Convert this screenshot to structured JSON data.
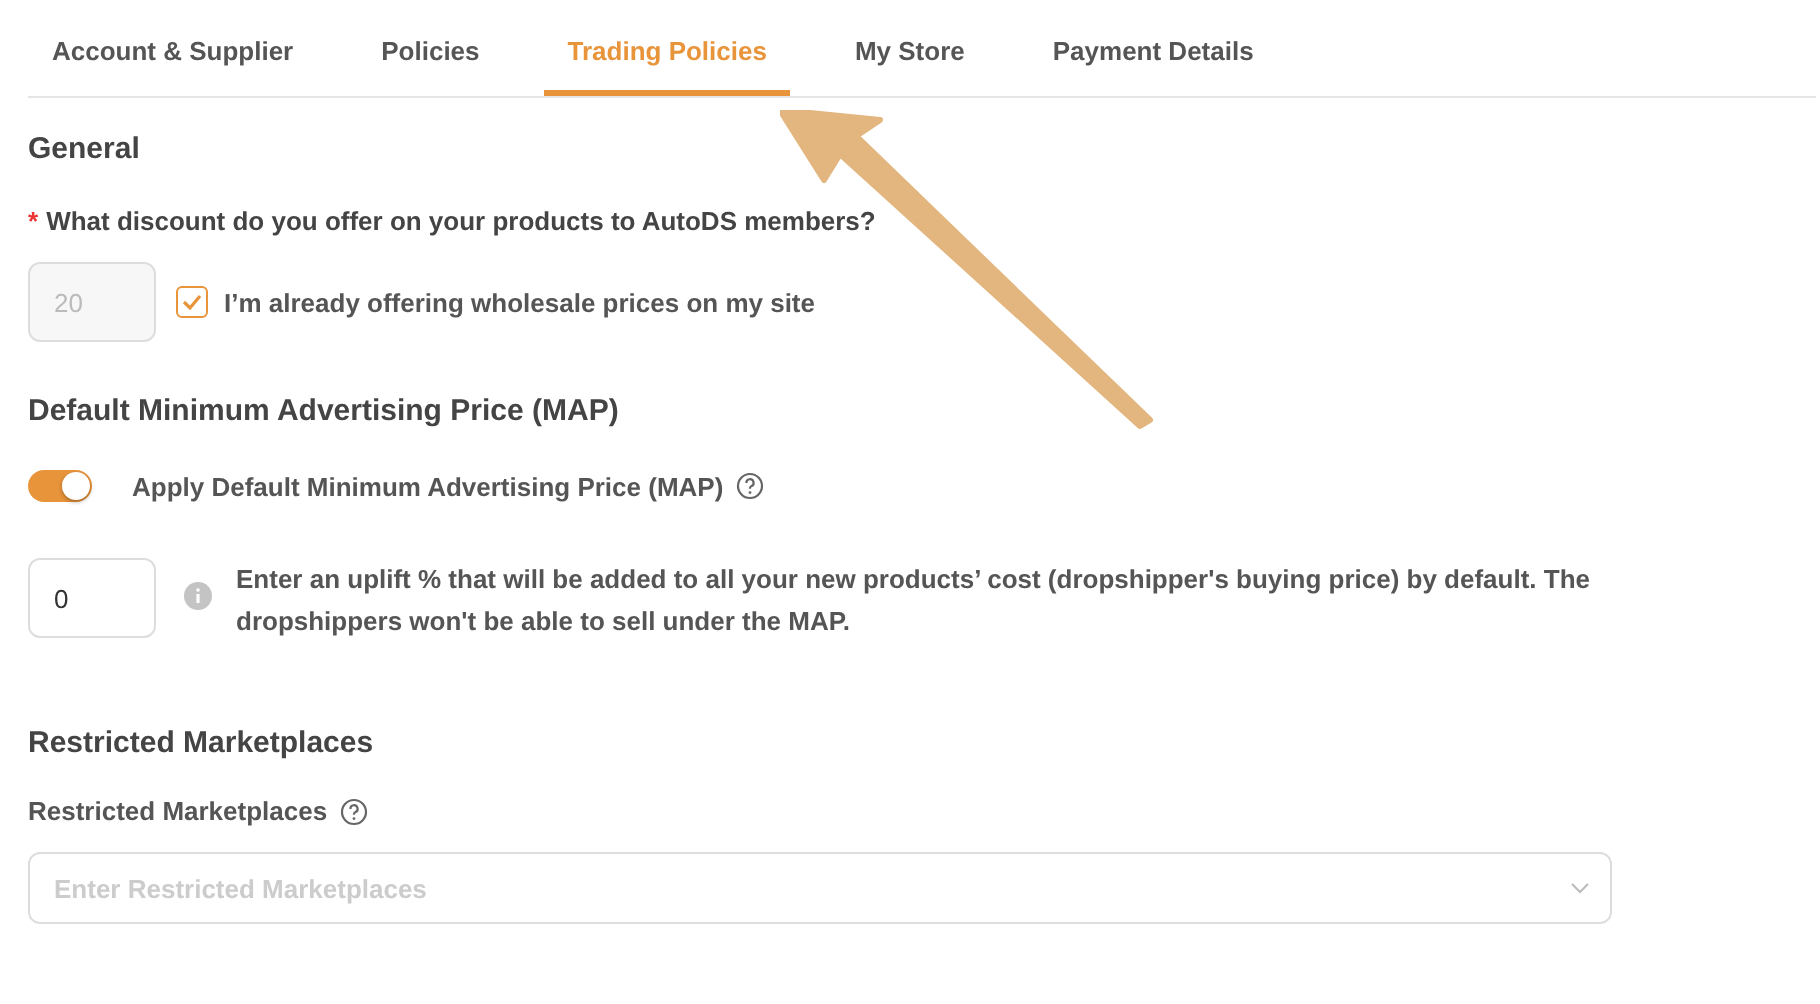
{
  "tabs": [
    {
      "label": "Account & Supplier",
      "selected": false
    },
    {
      "label": "Policies",
      "selected": false
    },
    {
      "label": "Trading Policies",
      "selected": true
    },
    {
      "label": "My Store",
      "selected": false
    },
    {
      "label": "Payment Details",
      "selected": false
    }
  ],
  "general": {
    "title": "General",
    "question": "What discount do you offer on your products to AutoDS members?",
    "required_mark": "*",
    "discount": {
      "value": "20",
      "disabled": true
    },
    "wholesale": {
      "label": "I’m already offering wholesale prices on my site",
      "checked": true
    }
  },
  "map": {
    "title": "Default Minimum Advertising Price (MAP)",
    "toggle": {
      "label": "Apply Default Minimum Advertising Price (MAP)",
      "on": true
    },
    "uplift": {
      "value": "0"
    },
    "description": "Enter an uplift % that will be added to all your new products’ cost (dropshipper's buying price) by default. The dropshippers won't be able to sell under the MAP."
  },
  "restricted": {
    "title": "Restricted Marketplaces",
    "label": "Restricted Marketplaces",
    "placeholder": "Enter Restricted Marketplaces"
  }
}
